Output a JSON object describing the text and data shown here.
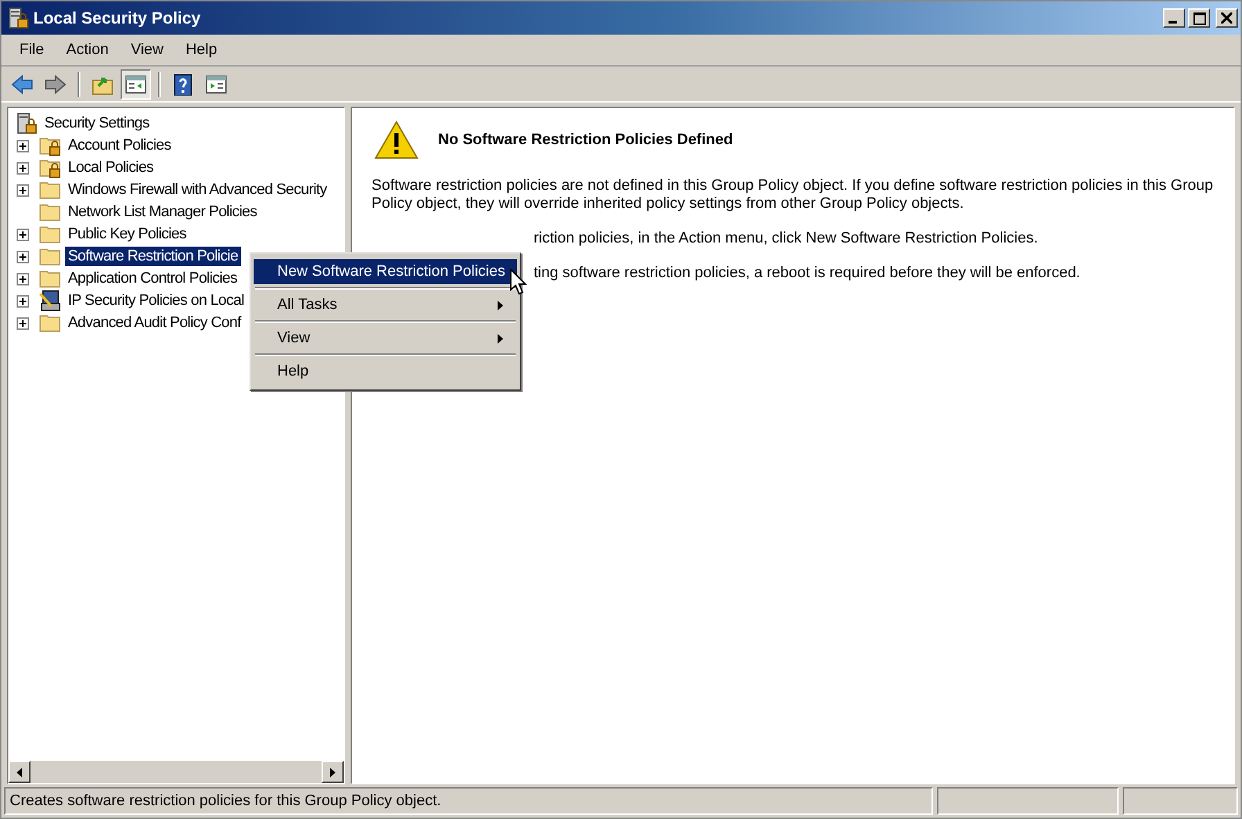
{
  "window": {
    "title": "Local Security Policy"
  },
  "menu_bar": [
    "File",
    "Action",
    "View",
    "Help"
  ],
  "toolbar": [
    {
      "kind": "back",
      "pressed": false
    },
    {
      "kind": "forward",
      "pressed": false
    },
    {
      "kind": "up",
      "pressed": false
    },
    {
      "kind": "console-tree",
      "pressed": true
    },
    {
      "kind": "help",
      "pressed": false
    },
    {
      "kind": "action-pane",
      "pressed": false
    }
  ],
  "tree": {
    "label": "Security Settings",
    "children": [
      {
        "label": "Account Policies",
        "kind": "locked-folder",
        "expandable": true,
        "selected": false
      },
      {
        "label": "Local Policies",
        "kind": "locked-folder",
        "expandable": true,
        "selected": false
      },
      {
        "label": "Windows Firewall with Advanced Security",
        "kind": "folder",
        "expandable": true,
        "selected": false
      },
      {
        "label": "Network List Manager Policies",
        "kind": "folder",
        "expandable": false,
        "selected": false
      },
      {
        "label": "Public Key Policies",
        "kind": "folder",
        "expandable": true,
        "selected": false
      },
      {
        "label": "Software Restriction Policie",
        "kind": "folder",
        "expandable": true,
        "selected": true
      },
      {
        "label": "Application Control Policies",
        "kind": "folder",
        "expandable": true,
        "selected": false
      },
      {
        "label": "IP Security Policies on Local",
        "kind": "computer",
        "expandable": true,
        "selected": false
      },
      {
        "label": "Advanced Audit Policy Conf",
        "kind": "folder",
        "expandable": true,
        "selected": false
      }
    ]
  },
  "detail": {
    "title": "No Software Restriction Policies Defined",
    "paragraphs": [
      {
        "text": "Software restriction policies are not defined in this Group Policy object. If you define software restriction policies in this Group Policy object, they will override inherited policy settings from other Group Policy objects.",
        "partly_hidden": false
      },
      {
        "text": "riction policies, in the Action menu, click New Software Restriction Policies.",
        "partly_hidden": true
      },
      {
        "text": "ting software restriction policies, a reboot is required before they will be enforced.",
        "partly_hidden": true
      }
    ]
  },
  "context_menu": [
    {
      "label": "New Software Restriction Policies",
      "submenu": false,
      "selected": true
    },
    {
      "label": "All Tasks",
      "submenu": true,
      "selected": false
    },
    {
      "label": "View",
      "submenu": true,
      "selected": false
    },
    {
      "label": "Help",
      "submenu": false,
      "selected": false
    }
  ],
  "status_bar": {
    "text": "Creates software restriction policies for this Group Policy object."
  }
}
